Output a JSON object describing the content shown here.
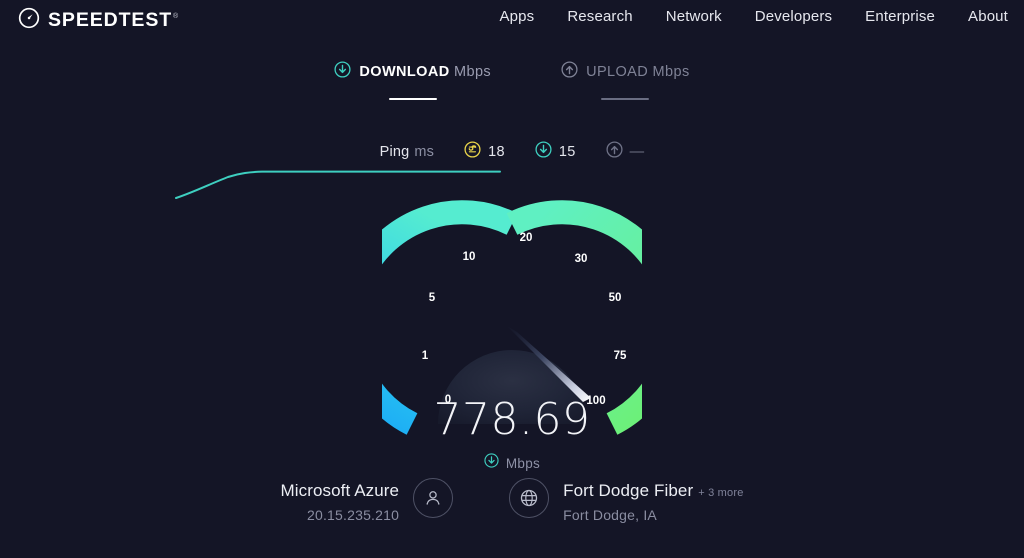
{
  "brand": {
    "name": "SPEEDTEST",
    "trademark": "®",
    "logo_icon": "speedometer-icon"
  },
  "nav": {
    "items": [
      {
        "label": "Apps"
      },
      {
        "label": "Research"
      },
      {
        "label": "Network"
      },
      {
        "label": "Developers"
      },
      {
        "label": "Enterprise"
      },
      {
        "label": "About"
      }
    ]
  },
  "tabs": [
    {
      "label": "DOWNLOAD",
      "unit": "Mbps",
      "icon": "arrow-down-circle-icon",
      "active": true
    },
    {
      "label": "UPLOAD",
      "unit": "Mbps",
      "icon": "arrow-up-circle-icon",
      "active": false
    }
  ],
  "ping": {
    "label": "Ping",
    "unit": "ms",
    "idle_icon": "latency-swap-icon",
    "idle_value": "18",
    "download_icon": "arrow-down-circle-icon",
    "download_value": "15",
    "upload_icon": "arrow-up-circle-icon",
    "upload_value": "—"
  },
  "result": {
    "value": "778.69",
    "unit": "Mbps",
    "unit_icon": "arrow-down-circle-icon"
  },
  "connection": {
    "host_name": "Microsoft Azure",
    "host_ip": "20.15.235.210",
    "host_icon": "person-circle-icon",
    "server_name": "Fort Dodge Fiber",
    "server_more": "+ 3 more",
    "server_location": "Fort Dodge, IA",
    "server_icon": "globe-circle-icon"
  },
  "colors": {
    "background": "#141526",
    "accent_teal": "#3ecfc0",
    "gauge_blue": "#18b5f2",
    "gauge_mint": "#5ef0c4",
    "gauge_green": "#6ef070",
    "ping_yellow": "#e8d44a",
    "muted_text": "#8a8da1"
  },
  "chart_data": {
    "type": "line",
    "title": "Download speed over time",
    "x": [
      0,
      10,
      20,
      30,
      40,
      50,
      60,
      70,
      80,
      90,
      100
    ],
    "values": [
      2,
      22,
      48,
      68,
      80,
      86,
      88,
      89,
      90,
      90,
      90
    ],
    "xlabel": "",
    "ylabel": "",
    "ylim": [
      0,
      100
    ],
    "grid": false,
    "legend": "none",
    "line_color": "#3ecfc0"
  },
  "gauge_data": {
    "type": "gauge",
    "value": 778.69,
    "unit": "Mbps",
    "needle_position": 100,
    "tick_labels": [
      "0",
      "1",
      "5",
      "10",
      "20",
      "30",
      "50",
      "75",
      "100"
    ],
    "scale_min": 0,
    "scale_max": 100,
    "arc_start_color": "#18b5f2",
    "arc_mid_color": "#5ef0c4",
    "arc_end_color": "#6ef070"
  }
}
